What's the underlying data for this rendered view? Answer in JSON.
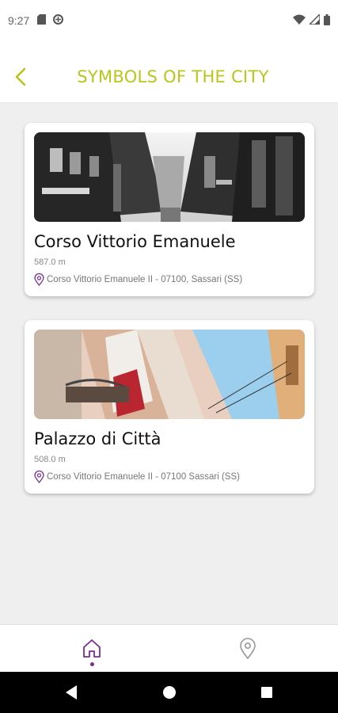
{
  "status_bar": {
    "time": "9:27",
    "icons": [
      "sd-card-icon",
      "data-saver-icon",
      "wifi-icon",
      "signal-icon",
      "battery-icon"
    ]
  },
  "header": {
    "title": "SYMBOLS OF THE CITY",
    "back_icon": "chevron-left-icon",
    "accent_color": "#b9c51d"
  },
  "places": [
    {
      "title": "Corso Vittorio Emanuele",
      "distance": "587.0 m",
      "address": "Corso Vittorio Emanuele II - 07100, Sassari (SS)",
      "image": "black-and-white street photo"
    },
    {
      "title": "Palazzo di Città",
      "distance": "508.0 m",
      "address": "Corso Vittorio Emanuele II - 07100 Sassari (SS)",
      "image": "building facade with flag"
    }
  ],
  "bottom_nav": {
    "items": [
      {
        "icon": "home-icon",
        "active": true
      },
      {
        "icon": "map-pin-icon",
        "active": false
      }
    ],
    "active_color": "#7a2c92"
  },
  "system_nav": [
    "back-icon",
    "home-circle-icon",
    "recents-icon"
  ]
}
